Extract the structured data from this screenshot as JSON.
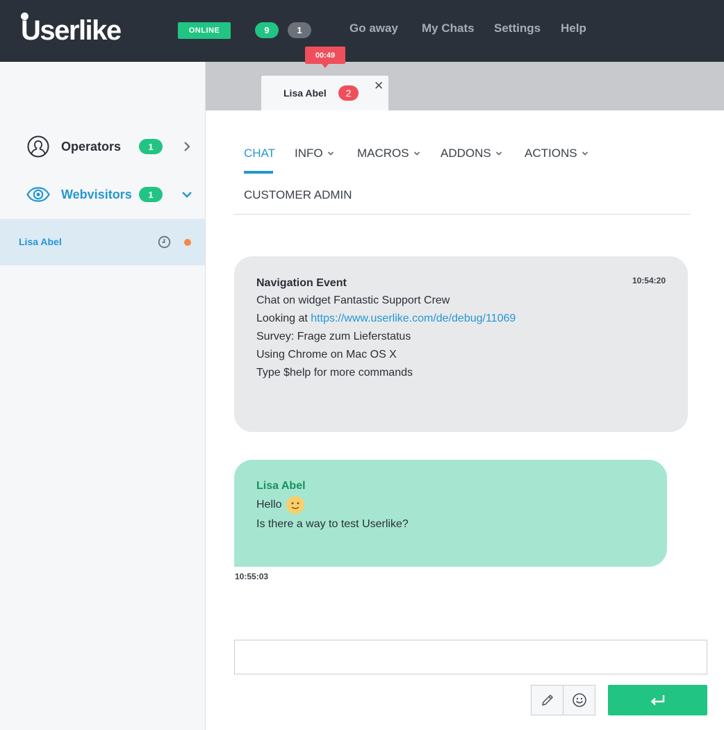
{
  "header": {
    "logo_text": "Userlike",
    "status": "ONLINE",
    "count_active": "9",
    "count_waiting": "1",
    "nav": [
      "Go away",
      "My Chats",
      "Settings",
      "Help"
    ]
  },
  "sidebar": {
    "groups": [
      {
        "label": "Operators",
        "count": "1",
        "icon": "user-circle-icon",
        "state": "collapsed"
      },
      {
        "label": "Webvisitors",
        "count": "1",
        "icon": "eye-icon",
        "state": "expanded"
      }
    ],
    "visitors": [
      {
        "name": "Lisa Abel",
        "icon": "clock-icon",
        "status_color": "#f5874a"
      }
    ]
  },
  "chat_tabs": [
    {
      "name": "Lisa Abel",
      "unread": "2",
      "timer": "00:49"
    }
  ],
  "menu": {
    "items": [
      {
        "label": "CHAT",
        "dropdown": false,
        "active": true
      },
      {
        "label": "INFO",
        "dropdown": true
      },
      {
        "label": "MACROS",
        "dropdown": true
      },
      {
        "label": "ADDONS",
        "dropdown": true
      },
      {
        "label": "ACTIONS",
        "dropdown": true
      },
      {
        "label": "CUSTOMER ADMIN",
        "dropdown": false
      }
    ]
  },
  "messages": {
    "system": {
      "title": "Navigation Event",
      "time": "10:54:20",
      "line1": "Chat on widget Fantastic Support Crew",
      "line2_prefix": "Looking at ",
      "line2_link": "https://www.userlike.com/de/debug/11069",
      "line3": "Survey: Frage zum Lieferstatus",
      "line4": "Using Chrome on Mac OS X",
      "line5": "Type $help for more commands"
    },
    "user": {
      "author": "Lisa Abel",
      "line1": "Hello",
      "line1_emoji": "slightly-smiling-face-emoji",
      "line2": "Is there a way to test Userlike?",
      "time": "10:55:03"
    }
  },
  "composer": {
    "value": "",
    "tools": [
      "pencil-icon",
      "smiley-icon"
    ],
    "send_icon": "return-arrow-icon"
  },
  "colors": {
    "topbar": "#2b313a",
    "accent_green": "#21c483",
    "accent_blue": "#2497d3",
    "alert_red": "#ef4f5b",
    "user_bubble": "#a6e6d0",
    "system_bubble": "#e8e9eb"
  }
}
